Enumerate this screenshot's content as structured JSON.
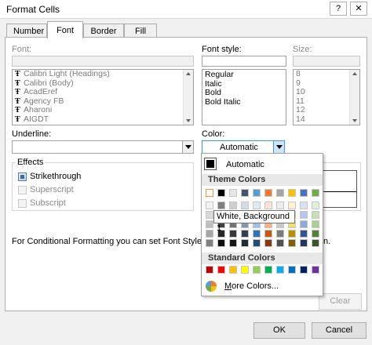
{
  "window": {
    "title": "Format Cells",
    "help_glyph": "?",
    "close_glyph": "✕"
  },
  "tabs": [
    {
      "label": "Number"
    },
    {
      "label": "Font"
    },
    {
      "label": "Border"
    },
    {
      "label": "Fill"
    }
  ],
  "font": {
    "label": "Font:",
    "items": [
      "Calibri Light (Headings)",
      "Calibri (Body)",
      "AcadEref",
      "Agency FB",
      "Aharoni",
      "AIGDT"
    ]
  },
  "font_style": {
    "label": "Font style:",
    "items": [
      "Regular",
      "Italic",
      "Bold",
      "Bold Italic"
    ]
  },
  "size": {
    "label": "Size:",
    "items": [
      "8",
      "9",
      "10",
      "11",
      "12",
      "14"
    ]
  },
  "underline": {
    "label": "Underline:"
  },
  "color": {
    "label": "Color:",
    "value": "Automatic"
  },
  "effects": {
    "title": "Effects",
    "strikethrough": "Strikethrough",
    "superscript": "Superscript",
    "subscript": "Subscript"
  },
  "info_text": "For Conditional Formatting you can set Font Style, U",
  "info_text_tail": "n.",
  "color_popup": {
    "automatic_label": "Automatic",
    "theme_header": "Theme Colors",
    "standard_header": "Standard Colors",
    "more_colors": "More Colors...",
    "tooltip": "White, Background 1",
    "theme_base": [
      "#ffffff",
      "#000000",
      "#e7e6e6",
      "#44546a",
      "#5b9bd5",
      "#ed7d31",
      "#a5a5a5",
      "#ffc000",
      "#4472c4",
      "#70ad47"
    ],
    "theme_shades": [
      [
        "#f2f2f2",
        "#7f7f7f",
        "#d0cece",
        "#d6dce4",
        "#ddebf7",
        "#fce4d6",
        "#ededed",
        "#fff2cc",
        "#d9e1f2",
        "#e2efda"
      ],
      [
        "#d9d9d9",
        "#595959",
        "#aeaaaa",
        "#adb9ca",
        "#bdd7ee",
        "#f8cbad",
        "#dbdbdb",
        "#ffe699",
        "#b4c6e7",
        "#c6e0b4"
      ],
      [
        "#bfbfbf",
        "#404040",
        "#757171",
        "#8497b0",
        "#9bc2e6",
        "#f4b084",
        "#c9c9c9",
        "#ffd966",
        "#8ea9db",
        "#a9d08e"
      ],
      [
        "#a6a6a6",
        "#262626",
        "#3a3838",
        "#333f4f",
        "#2f75b5",
        "#c65911",
        "#7b7b7b",
        "#bf8f00",
        "#305496",
        "#548235"
      ],
      [
        "#808080",
        "#0d0d0d",
        "#161616",
        "#222b35",
        "#1f4e78",
        "#833c0c",
        "#525252",
        "#806000",
        "#203764",
        "#375623"
      ]
    ],
    "standard": [
      "#c00000",
      "#ff0000",
      "#ffc000",
      "#ffff00",
      "#92d050",
      "#00b050",
      "#00b0f0",
      "#0070c0",
      "#002060",
      "#7030a0"
    ]
  },
  "buttons": {
    "clear": "Clear",
    "ok": "OK",
    "cancel": "Cancel"
  }
}
